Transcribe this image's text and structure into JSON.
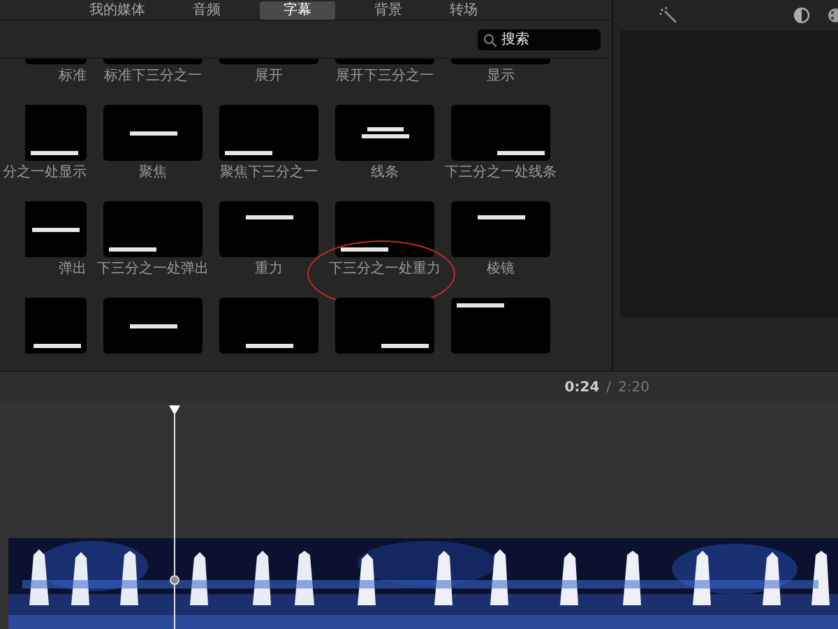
{
  "tabs": [
    {
      "label": "我的媒体",
      "selected": false
    },
    {
      "label": "音频",
      "selected": false
    },
    {
      "label": "字幕",
      "selected": true
    },
    {
      "label": "背景",
      "selected": false
    },
    {
      "label": "转场",
      "selected": false
    }
  ],
  "search": {
    "placeholder": "搜索"
  },
  "title_rows": [
    {
      "cut": true,
      "tiles": [
        {
          "label": "标准"
        },
        {
          "label": "标准下三分之一"
        },
        {
          "label": "展开"
        },
        {
          "label": "展开下三分之一"
        },
        {
          "label": "显示"
        }
      ]
    },
    {
      "cut": false,
      "tiles": [
        {
          "label": "分之一处显示",
          "kind": "bottom-left",
          "circled": false
        },
        {
          "label": "聚焦",
          "kind": "center",
          "circled": false
        },
        {
          "label": "聚焦下三分之一",
          "kind": "bottom-left",
          "circled": false
        },
        {
          "label": "线条",
          "kind": "two-lines",
          "circled": false
        },
        {
          "label": "下三分之一处线条",
          "kind": "bottom-right",
          "circled": false
        }
      ]
    },
    {
      "cut": false,
      "tiles": [
        {
          "label": "弹出",
          "kind": "center",
          "circled": false
        },
        {
          "label": "下三分之一处弹出",
          "kind": "bottom-left",
          "circled": false
        },
        {
          "label": "重力",
          "kind": "top-center",
          "circled": false
        },
        {
          "label": "下三分之一处重力",
          "kind": "bottom-left",
          "circled": true
        },
        {
          "label": "棱镜",
          "kind": "top-center",
          "circled": false
        }
      ]
    },
    {
      "cut": false,
      "tiles": [
        {
          "kind": "bottom-right",
          "circled": false
        },
        {
          "kind": "center",
          "circled": false
        },
        {
          "kind": "bottom-center",
          "circled": false
        },
        {
          "kind": "bottom-right",
          "circled": false
        },
        {
          "kind": "top-left",
          "circled": false
        }
      ]
    }
  ],
  "timeline": {
    "current": "0:24",
    "separator": "/",
    "total": "2:20"
  }
}
